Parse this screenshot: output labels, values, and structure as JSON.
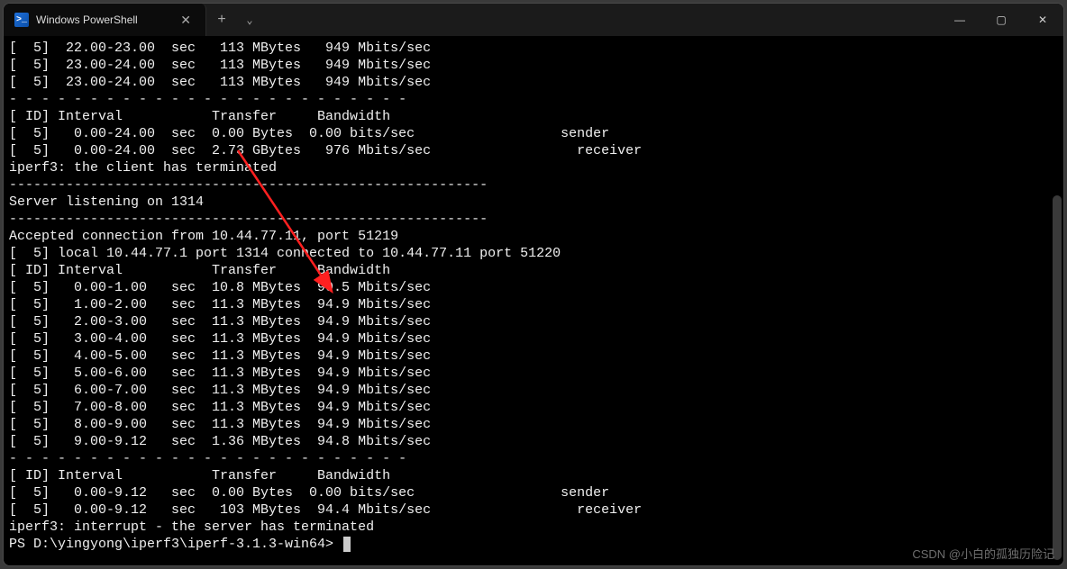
{
  "window": {
    "tab_title": "Windows PowerShell",
    "new_tab_glyph": "+",
    "dropdown_glyph": "⌄",
    "minimize_glyph": "—",
    "maximize_glyph": "▢",
    "close_glyph": "✕",
    "tab_close_glyph": "✕"
  },
  "terminal": {
    "top_rows": [
      "[  5]  22.00-23.00  sec   113 MBytes   949 Mbits/sec",
      "[  5]  23.00-24.00  sec   113 MBytes   949 Mbits/sec",
      "[  5]  23.00-24.00  sec   113 MBytes   949 Mbits/sec"
    ],
    "dash1": "- - - - - - - - - - - - - - - - - - - - - - - - -",
    "header1": "[ ID] Interval           Transfer     Bandwidth",
    "summary1": [
      "[  5]   0.00-24.00  sec  0.00 Bytes  0.00 bits/sec                  sender",
      "[  5]   0.00-24.00  sec  2.73 GBytes   976 Mbits/sec                  receiver"
    ],
    "client_term": "iperf3: the client has terminated",
    "hr1": "-----------------------------------------------------------",
    "listening": "Server listening on 1314",
    "hr2": "-----------------------------------------------------------",
    "accepted": "Accepted connection from 10.44.77.11, port 51219",
    "local": "[  5] local 10.44.77.1 port 1314 connected to 10.44.77.11 port 51220",
    "header2": "[ ID] Interval           Transfer     Bandwidth",
    "rows2": [
      "[  5]   0.00-1.00   sec  10.8 MBytes  90.5 Mbits/sec",
      "[  5]   1.00-2.00   sec  11.3 MBytes  94.9 Mbits/sec",
      "[  5]   2.00-3.00   sec  11.3 MBytes  94.9 Mbits/sec",
      "[  5]   3.00-4.00   sec  11.3 MBytes  94.9 Mbits/sec",
      "[  5]   4.00-5.00   sec  11.3 MBytes  94.9 Mbits/sec",
      "[  5]   5.00-6.00   sec  11.3 MBytes  94.9 Mbits/sec",
      "[  5]   6.00-7.00   sec  11.3 MBytes  94.9 Mbits/sec",
      "[  5]   7.00-8.00   sec  11.3 MBytes  94.9 Mbits/sec",
      "[  5]   8.00-9.00   sec  11.3 MBytes  94.9 Mbits/sec",
      "[  5]   9.00-9.12   sec  1.36 MBytes  94.8 Mbits/sec"
    ],
    "dash2": "- - - - - - - - - - - - - - - - - - - - - - - - -",
    "header3": "[ ID] Interval           Transfer     Bandwidth",
    "summary2": [
      "[  5]   0.00-9.12   sec  0.00 Bytes  0.00 bits/sec                  sender",
      "[  5]   0.00-9.12   sec   103 MBytes  94.4 Mbits/sec                  receiver"
    ],
    "interrupt": "iperf3: interrupt - the server has terminated",
    "prompt": "PS D:\\yingyong\\iperf3\\iperf-3.1.3-win64> "
  },
  "watermark": "CSDN @小白的孤独历险记"
}
